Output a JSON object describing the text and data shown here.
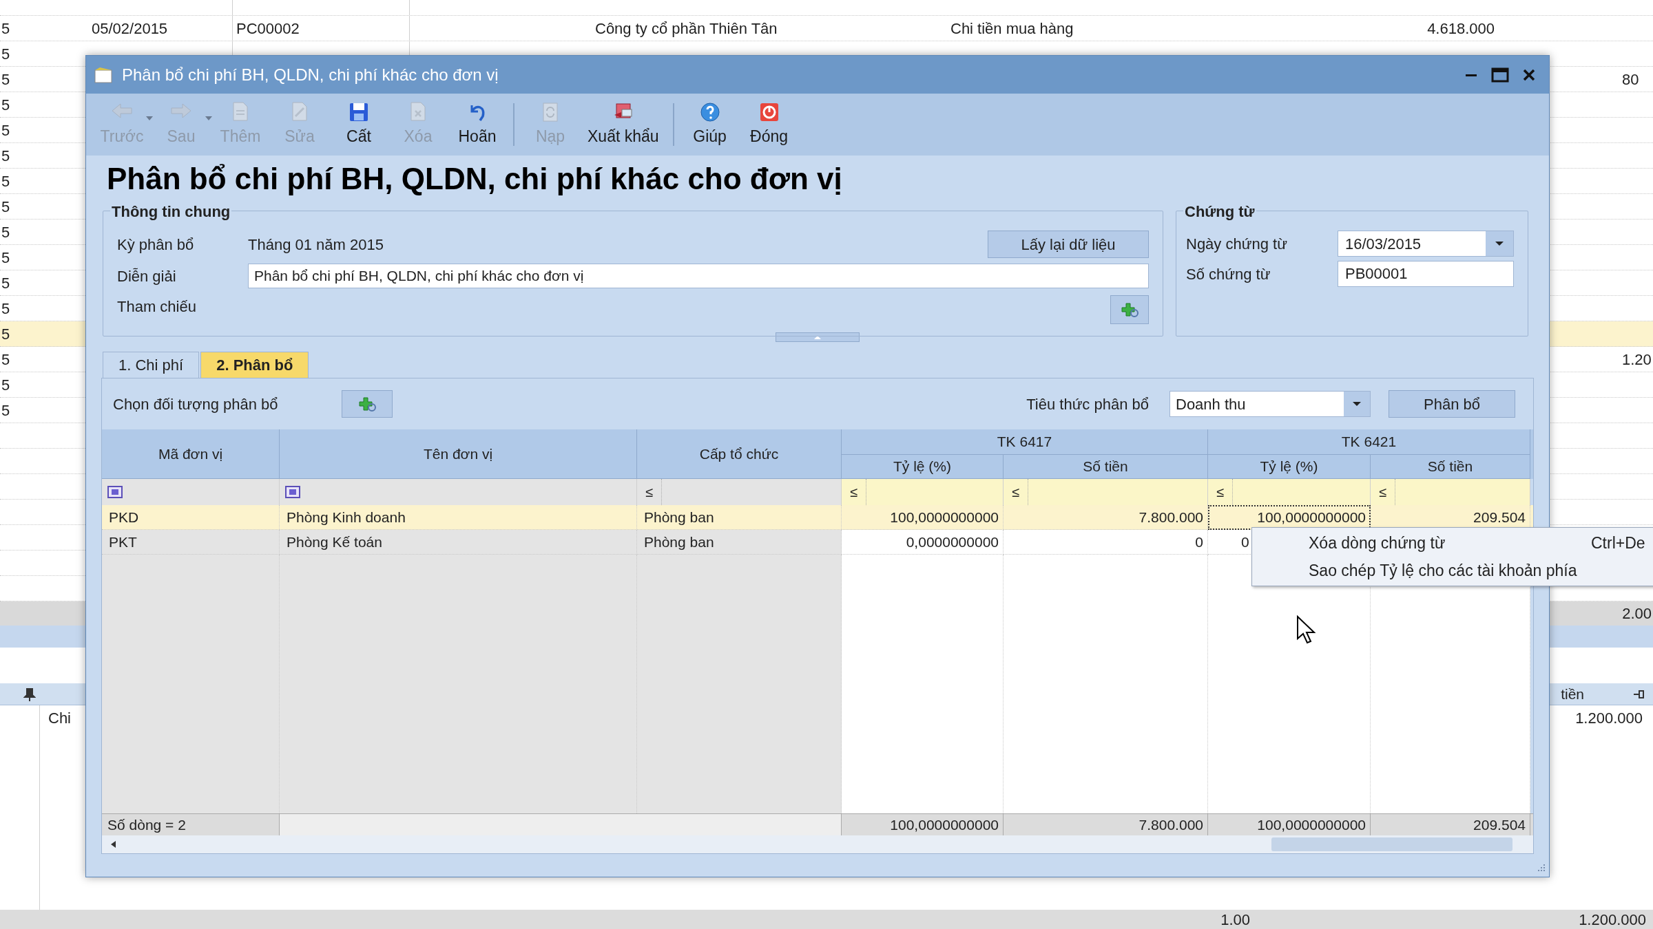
{
  "background_list": {
    "rows": [
      {
        "selected": false
      },
      {
        "number": "5",
        "date": "05/02/2015",
        "code": "PC00002",
        "company": "Công ty cổ phần Thiên Tân",
        "description": "Chi tiền mua hàng",
        "amount": "4.618.000",
        "selected": false
      },
      {
        "number": "5",
        "selected": false
      },
      {
        "number": "5",
        "extra": "80",
        "selected": false
      },
      {
        "number": "5",
        "selected": false
      },
      {
        "number": "5",
        "selected": false
      },
      {
        "number": "5",
        "selected": false
      },
      {
        "number": "5",
        "selected": false
      },
      {
        "number": "5",
        "selected": false
      },
      {
        "number": "5",
        "selected": false
      },
      {
        "number": "5",
        "selected": false
      },
      {
        "number": "5",
        "selected": false
      },
      {
        "number": "5",
        "selected": false
      },
      {
        "number": "5",
        "selected": true
      },
      {
        "number": "5",
        "extra": "1.20",
        "selected": false
      },
      {
        "number": "5",
        "selected": false
      },
      {
        "number": "5",
        "selected": false
      }
    ]
  },
  "background_lower": {
    "total_extra": "2.00",
    "header_label": "tiền",
    "row_label": "Chi",
    "row_amount": "1.200.000",
    "footer_values": [
      "1.00",
      "1.200.000"
    ]
  },
  "window": {
    "title": "Phân bổ chi phí BH, QLDN, chi phí khác cho đơn vị"
  },
  "toolbar": [
    {
      "kind": "back",
      "label": "Trước",
      "disabled": true,
      "dropdown": true
    },
    {
      "kind": "forward",
      "label": "Sau",
      "disabled": true,
      "dropdown": true
    },
    {
      "kind": "add",
      "label": "Thêm",
      "disabled": true,
      "dropdown": false
    },
    {
      "kind": "edit",
      "label": "Sửa",
      "disabled": true,
      "dropdown": false
    },
    {
      "kind": "save",
      "label": "Cất",
      "disabled": false,
      "dropdown": false
    },
    {
      "kind": "delete",
      "label": "Xóa",
      "disabled": true,
      "dropdown": false
    },
    {
      "kind": "undo",
      "label": "Hoãn",
      "disabled": false,
      "dropdown": false
    },
    {
      "kind": "separator"
    },
    {
      "kind": "reload",
      "label": "Nạp",
      "disabled": true,
      "dropdown": false
    },
    {
      "kind": "export",
      "label": "Xuất khẩu",
      "disabled": false,
      "dropdown": false
    },
    {
      "kind": "separator"
    },
    {
      "kind": "help",
      "label": "Giúp",
      "disabled": false,
      "dropdown": false
    },
    {
      "kind": "close",
      "label": "Đóng",
      "disabled": false,
      "dropdown": false
    }
  ],
  "heading": "Phân bổ chi phí BH, QLDN, chi phí khác cho đơn vị",
  "general_info": {
    "title": "Thông tin chung",
    "period_label": "Kỳ phân bổ",
    "period_value": "Tháng 01 năm 2015",
    "reload_button": "Lấy lại dữ liệu",
    "description_label": "Diễn giải",
    "description_value": "Phân bổ chi phí BH, QLDN, chi phí khác cho đơn vị",
    "reference_label": "Tham chiếu"
  },
  "voucher": {
    "title": "Chứng từ",
    "date_label": "Ngày chứng từ",
    "date_value": "16/03/2015",
    "number_label": "Số chứng từ",
    "number_value": "PB00001"
  },
  "tabs": [
    {
      "label": "1. Chi phí",
      "selected": false
    },
    {
      "label": "2. Phân bổ",
      "selected": true
    }
  ],
  "allocation": {
    "choose_label": "Chọn đối tượng phân bổ",
    "criteria_label": "Tiêu thức phân bổ",
    "criteria_value": "Doanh thu",
    "allocate_button": "Phân bổ"
  },
  "grid": {
    "columns": [
      "Mã đơn vị",
      "Tên đơn vị",
      "Cấp tổ chức"
    ],
    "groups": [
      {
        "label": "TK 6417",
        "columns": [
          "Tỷ lệ (%)",
          "Số tiền"
        ]
      },
      {
        "label": "TK 6421",
        "columns": [
          "Tỷ lệ (%)",
          "Số tiền"
        ]
      }
    ],
    "filters": [
      {
        "kind": "icon"
      },
      {
        "kind": "icon"
      },
      {
        "kind": "operator",
        "text": "≤"
      },
      {
        "kind": "operator",
        "text": "≤"
      },
      {
        "kind": "operator",
        "text": "≤"
      },
      {
        "kind": "operator",
        "text": "≤"
      },
      {
        "kind": "operator",
        "text": "≤"
      }
    ],
    "rows": [
      {
        "selected": true,
        "cells": [
          {
            "text": "PKD",
            "focused": false,
            "partial": false
          },
          {
            "text": "Phòng Kinh doanh",
            "focused": false,
            "partial": false
          },
          {
            "text": "Phòng ban",
            "focused": false,
            "partial": false
          },
          {
            "text": "100,0000000000",
            "focused": false,
            "partial": false
          },
          {
            "text": "7.800.000",
            "focused": false,
            "partial": false
          },
          {
            "text": "100,0000000000",
            "focused": true,
            "partial": false
          },
          {
            "text": "209.504",
            "focused": false,
            "partial": false
          }
        ]
      },
      {
        "selected": false,
        "cells": [
          {
            "text": "PKT",
            "focused": false,
            "partial": false
          },
          {
            "text": "Phòng Kế toán",
            "focused": false,
            "partial": false
          },
          {
            "text": "Phòng ban",
            "focused": false,
            "partial": false
          },
          {
            "text": "0,0000000000",
            "focused": false,
            "partial": false
          },
          {
            "text": "0",
            "focused": false,
            "partial": false
          },
          {
            "text": "0",
            "focused": false,
            "partial": true
          }
        ]
      }
    ],
    "footer": {
      "label": "Số dòng = 2",
      "totals": [
        "100,0000000000",
        "7.800.000",
        "100,0000000000",
        "209.504"
      ]
    }
  },
  "context_menu": [
    {
      "label": "Xóa dòng chứng từ",
      "shortcut": "Ctrl+De"
    },
    {
      "label": "Sao chép Tỷ lệ cho các tài khoản phía"
    }
  ]
}
